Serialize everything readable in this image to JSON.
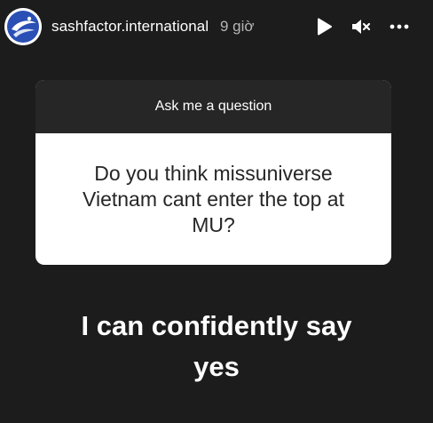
{
  "header": {
    "username": "sashfactor.international",
    "time": "9 giờ",
    "icons": {
      "avatar": "sashfactor-logo-avatar",
      "play": "play-icon",
      "mute": "mute-icon",
      "more": "more-icon"
    }
  },
  "question_card": {
    "prompt": "Ask me a question",
    "question": "Do you think missuniverse Vietnam cant enter the top at MU?"
  },
  "answer": {
    "line1": "I can confidently say",
    "line2": "yes"
  },
  "colors": {
    "background": "#1c1c1c",
    "card_header": "#262626",
    "card_body": "#ffffff",
    "avatar_accent": "#2a4fb5"
  }
}
